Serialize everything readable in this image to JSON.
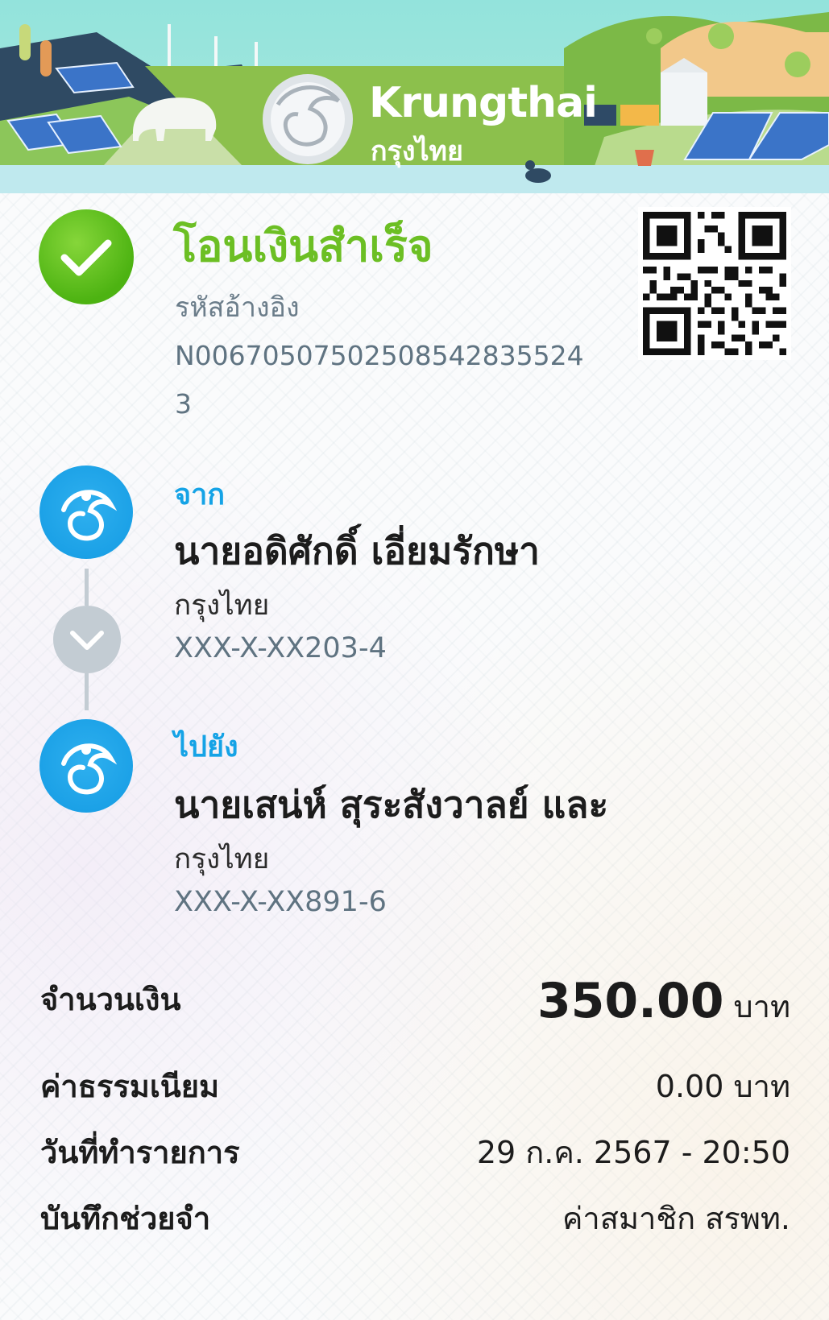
{
  "header": {
    "brand_name": "Krungthai",
    "brand_name_thai": "กรุงไทย"
  },
  "status": {
    "title": "โอนเงินสำเร็จ",
    "ref_label": "รหัสอ้างอิง",
    "ref_value": "N00670507502508542835524 3"
  },
  "sender": {
    "label": "จาก",
    "name": "นายอดิศักดิ์ เอี่ยมรักษา",
    "bank": "กรุงไทย",
    "account": "XXX-X-XX203-4"
  },
  "receiver": {
    "label": "ไปยัง",
    "name": "นายเสน่ห์ สุระสังวาลย์ และ",
    "bank": "กรุงไทย",
    "account": "XXX-X-XX891-6"
  },
  "details": {
    "amount_label": "จำนวนเงิน",
    "amount_value": "350.00",
    "amount_unit": "บาท",
    "fee_label": "ค่าธรรมเนียม",
    "fee_value": "0.00 บาท",
    "date_label": "วันที่ทำรายการ",
    "date_value": "29 ก.ค. 2567 - 20:50",
    "memo_label": "บันทึกช่วยจำ",
    "memo_value": "ค่าสมาชิก สรพท."
  },
  "colors": {
    "success_green": "#6cbf24",
    "accent_blue": "#15a3e6",
    "muted_text": "#5f7381"
  }
}
